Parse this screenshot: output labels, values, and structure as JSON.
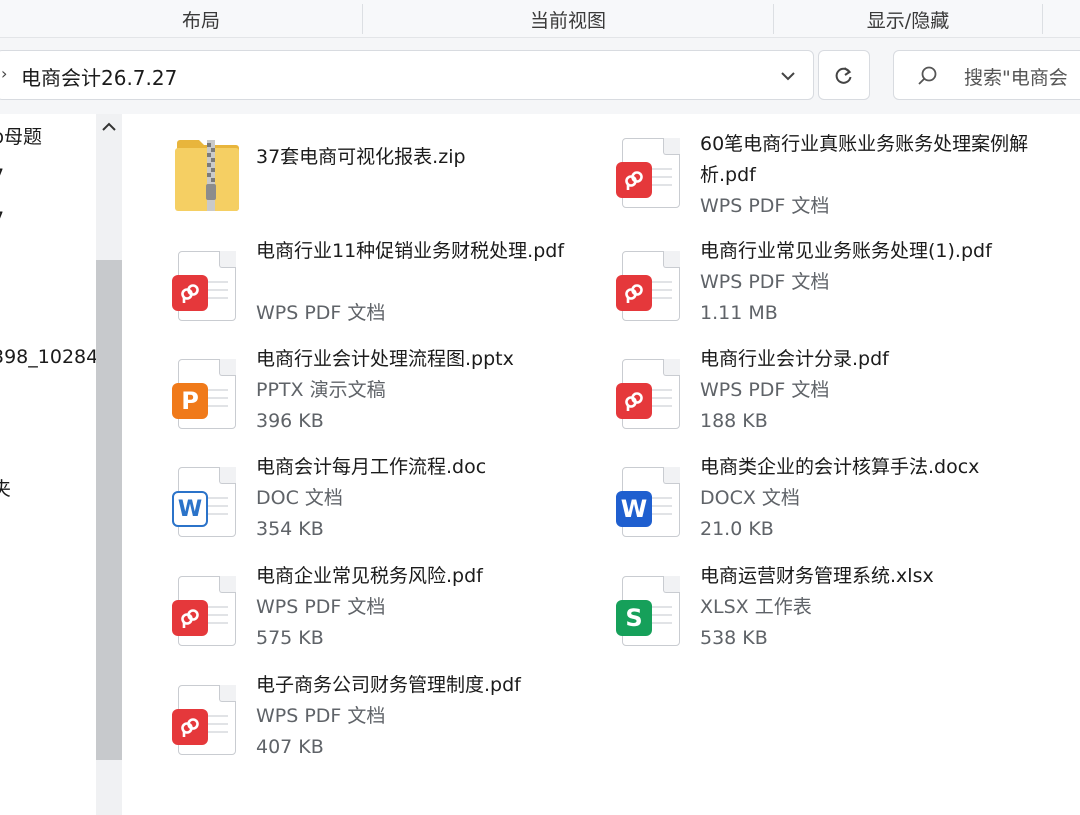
{
  "ribbon": {
    "groups": [
      "布局",
      "当前视图",
      "显示/隐藏"
    ]
  },
  "address": {
    "path": "电商会计26.7.27",
    "search_placeholder": "搜索\"电商会"
  },
  "nav": {
    "items": [
      "p母题",
      "7",
      "7",
      "398_10284",
      "夹"
    ]
  },
  "files": [
    {
      "name": "37套电商可视化报表.zip",
      "type": "zip",
      "meta1": "",
      "meta2": ""
    },
    {
      "name": "60笔电商行业真账业务账务处理案例解析.pdf",
      "type": "pdf",
      "meta1": "WPS PDF 文档",
      "meta2": ""
    },
    {
      "name": "电商行业11种促销业务财税处理.pdf",
      "type": "pdf",
      "meta1": "WPS PDF 文档",
      "meta2": ""
    },
    {
      "name": "电商行业常见业务账务处理(1).pdf",
      "type": "pdf",
      "meta1": "WPS PDF 文档",
      "meta2": "1.11 MB"
    },
    {
      "name": "电商行业会计处理流程图.pptx",
      "type": "pptx",
      "meta1": "PPTX 演示文稿",
      "meta2": "396 KB"
    },
    {
      "name": "电商行业会计分录.pdf",
      "type": "pdf",
      "meta1": "WPS PDF 文档",
      "meta2": "188 KB"
    },
    {
      "name": "电商会计每月工作流程.doc",
      "type": "doc",
      "meta1": "DOC 文档",
      "meta2": "354 KB"
    },
    {
      "name": "电商类企业的会计核算手法.docx",
      "type": "docx",
      "meta1": "DOCX 文档",
      "meta2": "21.0 KB"
    },
    {
      "name": "电商企业常见税务风险.pdf",
      "type": "pdf",
      "meta1": "WPS PDF 文档",
      "meta2": "575 KB"
    },
    {
      "name": "电商运营财务管理系统.xlsx",
      "type": "xlsx",
      "meta1": "XLSX 工作表",
      "meta2": "538 KB"
    },
    {
      "name": "电子商务公司财务管理制度.pdf",
      "type": "pdf",
      "meta1": "WPS PDF 文档",
      "meta2": "407 KB"
    }
  ],
  "colors": {
    "pdf": "#e5383b",
    "pptx": "#f07a1a",
    "doc": "#2b73c9",
    "docx": "#1f5fcf",
    "xlsx": "#16a05a",
    "zip": "#f2c94c"
  },
  "icons": {
    "zip": "zip-folder-icon",
    "pdf": "wps-pdf-icon",
    "pptx": "pptx-icon",
    "doc": "doc-icon",
    "docx": "docx-icon",
    "xlsx": "xlsx-icon"
  }
}
